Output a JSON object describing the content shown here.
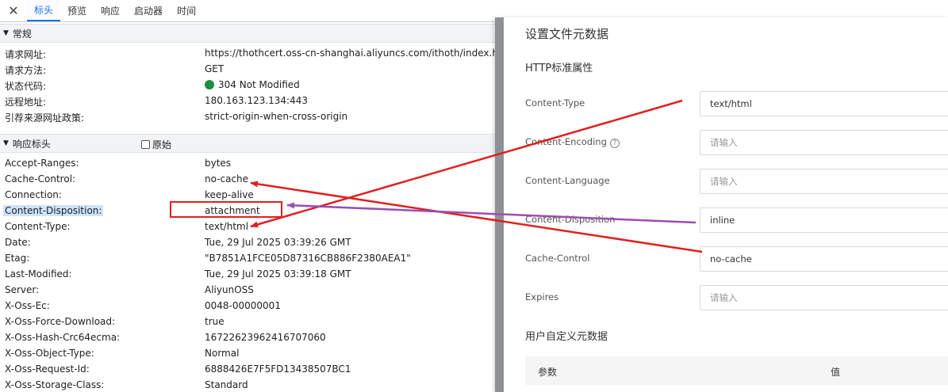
{
  "tabs": {
    "close_icon": "close-icon",
    "items": [
      "标头",
      "预览",
      "响应",
      "启动器",
      "时间"
    ],
    "active": "标头"
  },
  "general": {
    "title": "常规",
    "rows": [
      {
        "k": "请求网址:",
        "v": "https://thothcert.oss-cn-shanghai.aliyuncs.com/ithoth/index.htm"
      },
      {
        "k": "请求方法:",
        "v": "GET"
      },
      {
        "k": "状态代码:",
        "v": "304 Not Modified"
      },
      {
        "k": "远程地址:",
        "v": "180.163.123.134:443"
      },
      {
        "k": "引荐来源网址政策:",
        "v": "strict-origin-when-cross-origin"
      }
    ]
  },
  "response_headers": {
    "title": "响应标头",
    "raw_label": "原始",
    "rows": [
      {
        "k": "Accept-Ranges:",
        "v": "bytes"
      },
      {
        "k": "Cache-Control:",
        "v": "no-cache"
      },
      {
        "k": "Connection:",
        "v": "keep-alive"
      },
      {
        "k": "Content-Disposition:",
        "v": "attachment"
      },
      {
        "k": "Content-Type:",
        "v": "text/html"
      },
      {
        "k": "Date:",
        "v": "Tue, 29 Jul 2025 03:39:26 GMT"
      },
      {
        "k": "Etag:",
        "v": "\"B7851A1FCE05D87316CB886F2380AEA1\""
      },
      {
        "k": "Last-Modified:",
        "v": "Tue, 29 Jul 2025 03:39:18 GMT"
      },
      {
        "k": "Server:",
        "v": "AliyunOSS"
      },
      {
        "k": "X-Oss-Ec:",
        "v": "0048-00000001"
      },
      {
        "k": "X-Oss-Force-Download:",
        "v": "true"
      },
      {
        "k": "X-Oss-Hash-Crc64ecma:",
        "v": "16722623962416707060"
      },
      {
        "k": "X-Oss-Object-Type:",
        "v": "Normal"
      },
      {
        "k": "X-Oss-Request-Id:",
        "v": "6888426E7F5FD13438507BC1"
      },
      {
        "k": "X-Oss-Storage-Class:",
        "v": "Standard"
      }
    ]
  },
  "panel": {
    "title": "设置文件元数据",
    "subtitle": "HTTP标准属性",
    "fields": [
      {
        "label": "Content-Type",
        "value": "text/html",
        "placeholder": ""
      },
      {
        "label": "Content-Encoding",
        "value": "",
        "placeholder": "请输入",
        "help_icon": "question-circle-icon"
      },
      {
        "label": "Content-Language",
        "value": "",
        "placeholder": "请输入"
      },
      {
        "label": "Content-Disposition",
        "value": "inline",
        "placeholder": ""
      },
      {
        "label": "Cache-Control",
        "value": "no-cache",
        "placeholder": ""
      },
      {
        "label": "Expires",
        "value": "",
        "placeholder": "请输入"
      }
    ],
    "custom_title": "用户自定义元数据",
    "table_cols": [
      "参数",
      "值"
    ]
  },
  "colors": {
    "arrow_red": "#e02020",
    "arrow_purple": "#9b4fb0",
    "accent": "#1a73e8"
  }
}
